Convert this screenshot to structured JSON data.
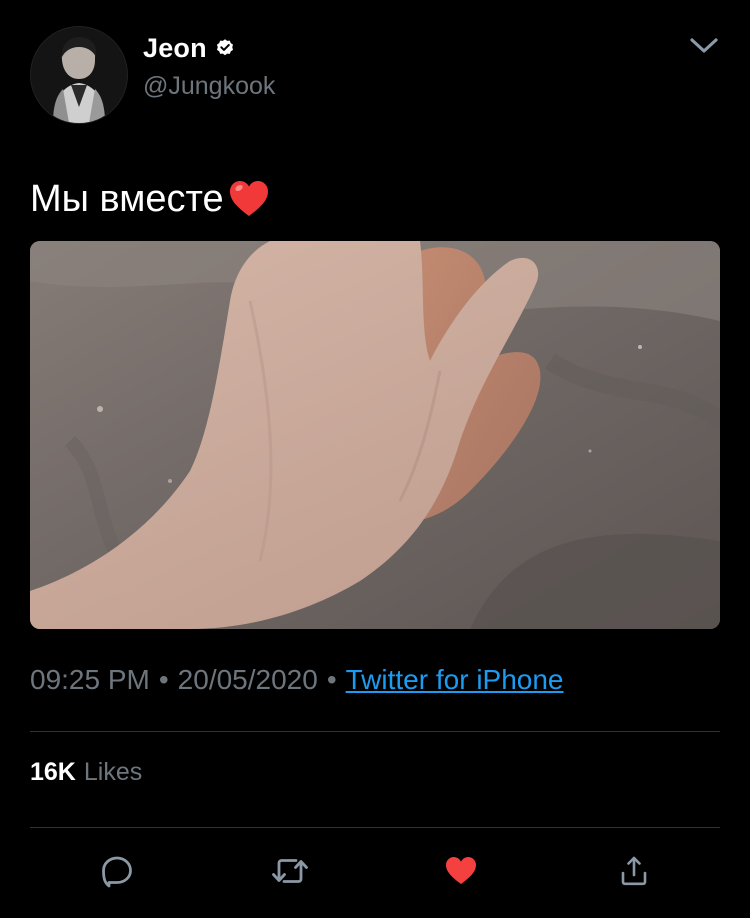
{
  "user": {
    "display_name": "Jeon",
    "handle": "@Jungkook",
    "verified": true
  },
  "tweet": {
    "text": "Мы вместе",
    "emoji": "red-heart-emoji",
    "timestamp_time": "09:25 PM",
    "timestamp_date": "20/05/2020",
    "separator": "•",
    "source": "Twitter for iPhone",
    "likes_count": "16K",
    "likes_label": "Likes"
  },
  "icons": {
    "more": "chevron-down-icon",
    "reply": "reply-icon",
    "retweet": "retweet-icon",
    "like": "heart-icon",
    "share": "share-icon"
  },
  "colors": {
    "background": "#000000",
    "text_primary": "#ffffff",
    "text_secondary": "#6e767d",
    "link": "#1d9bf0",
    "like_active": "#f4403f",
    "divider": "#2f3336"
  }
}
